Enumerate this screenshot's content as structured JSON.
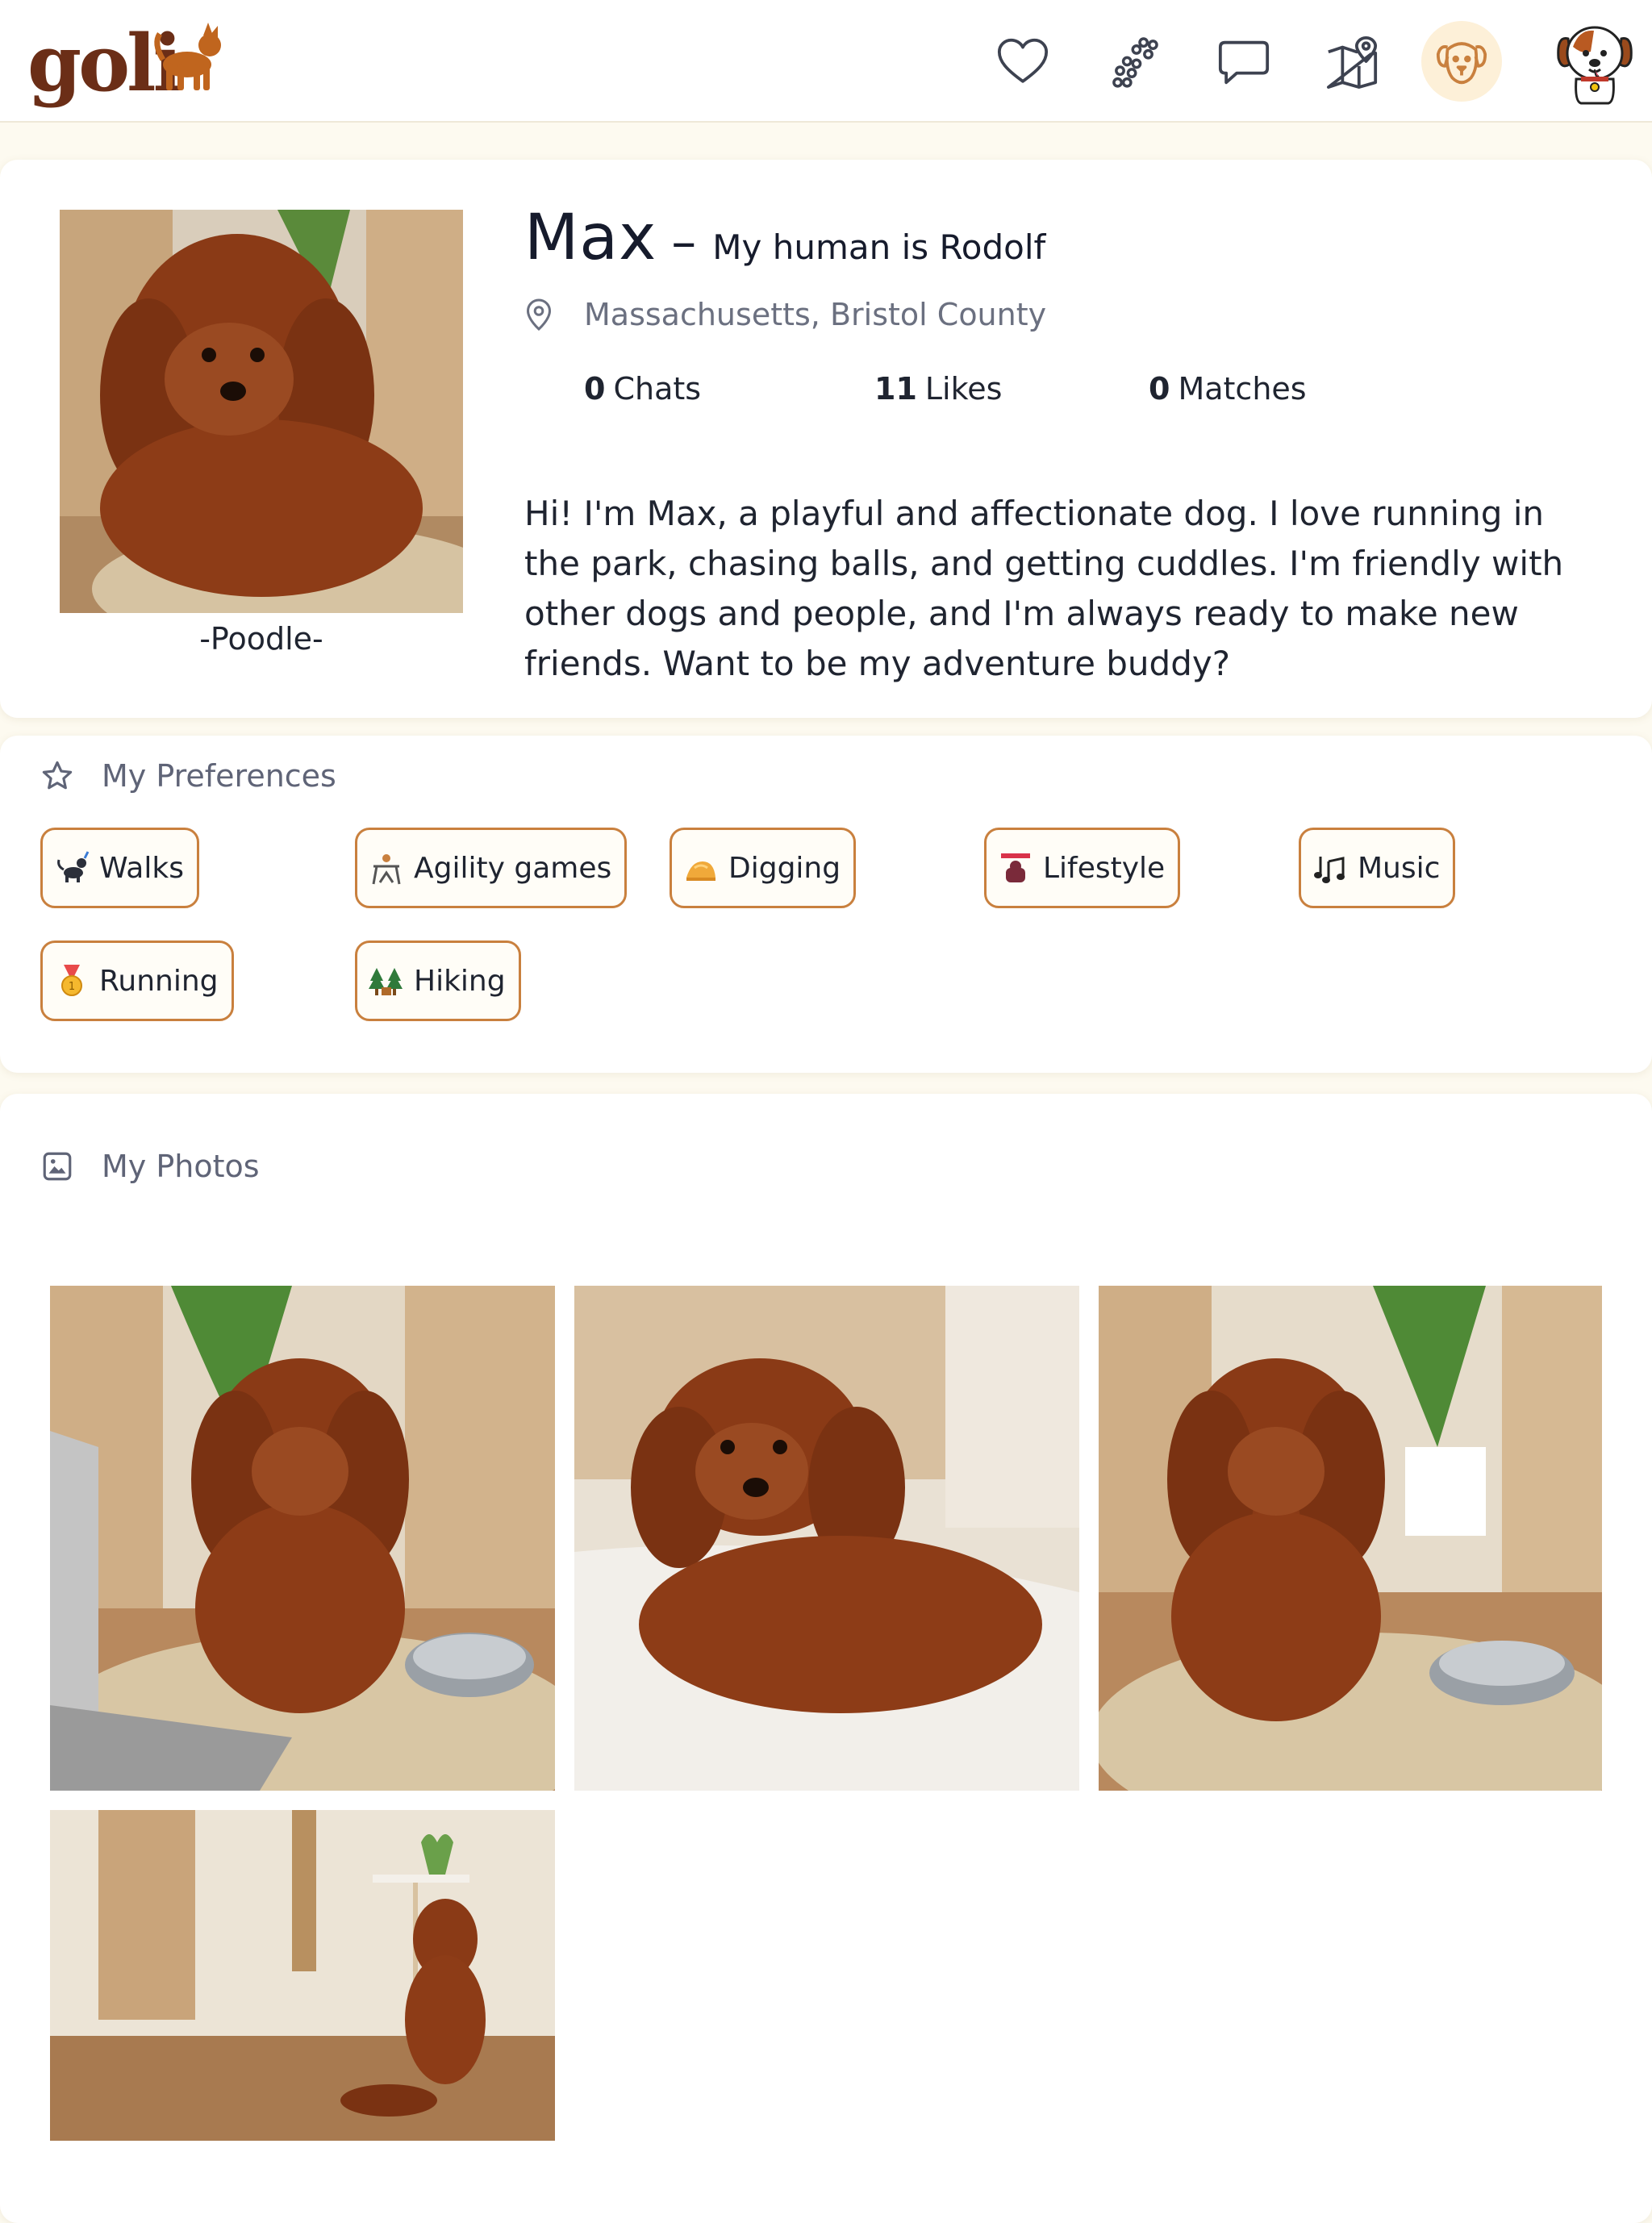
{
  "header": {
    "logo_text": "goli",
    "nav": [
      {
        "icon": "heart-icon",
        "label": "Likes"
      },
      {
        "icon": "paw-icon",
        "label": "Discover"
      },
      {
        "icon": "chat-icon",
        "label": "Chats"
      },
      {
        "icon": "map-icon",
        "label": "Map"
      },
      {
        "icon": "dog-face-icon",
        "label": "My dog",
        "active": true
      }
    ],
    "avatar": "puppy-avatar"
  },
  "profile": {
    "name": "Max",
    "separator": "–",
    "human": "My human is Rodolf",
    "location": "Massachusetts, Bristol County",
    "breed": "-Poodle-",
    "stats": [
      {
        "value": "0",
        "label": "Chats"
      },
      {
        "value": "11",
        "label": "Likes"
      },
      {
        "value": "0",
        "label": "Matches"
      }
    ],
    "bio": "Hi! I'm Max, a playful and affectionate dog. I love running in the park, chasing balls, and getting cuddles. I'm friendly with other dogs and people, and I'm always ready to make new friends. Want to be my adventure buddy?"
  },
  "preferences": {
    "title": "My Preferences",
    "items": [
      {
        "label": "Walks",
        "icon": "dog-walk-emoji"
      },
      {
        "label": "Agility games",
        "icon": "agility-emoji"
      },
      {
        "label": "Digging",
        "icon": "digging-emoji"
      },
      {
        "label": "Lifestyle",
        "icon": "lifestyle-emoji"
      },
      {
        "label": "Music",
        "icon": "music-notes-emoji"
      },
      {
        "label": "Running",
        "icon": "medal-emoji"
      },
      {
        "label": "Hiking",
        "icon": "trees-emoji"
      }
    ]
  },
  "photos": {
    "title": "My Photos",
    "count": 4
  },
  "colors": {
    "accent_border": "#c9803e",
    "background": "#fdfaf0",
    "active_nav_bg": "#fdf0d8",
    "brand_brown": "#7a3a1a"
  }
}
